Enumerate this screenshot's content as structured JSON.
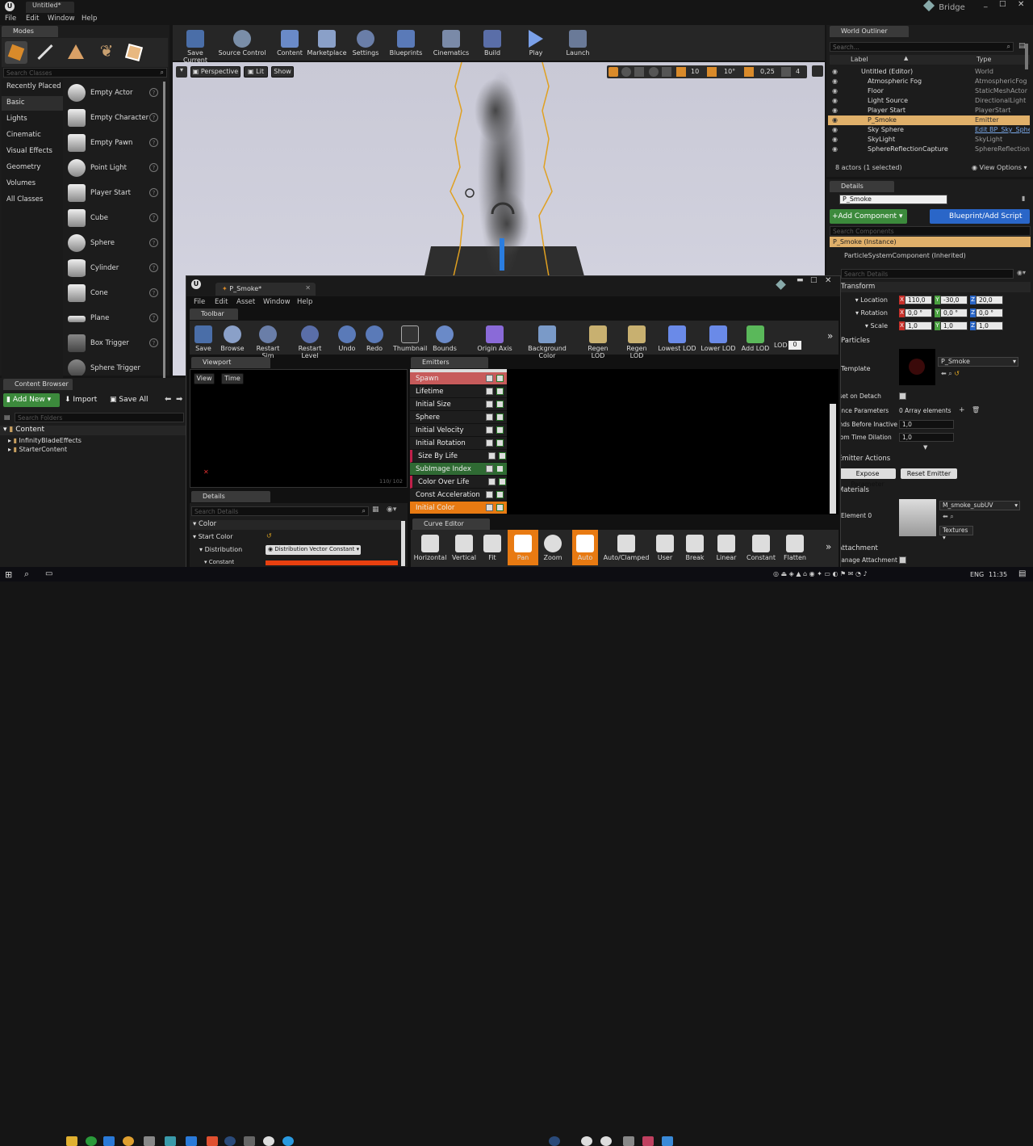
{
  "title_bar": {
    "title": "Untitled*",
    "bridge": "Bridge"
  },
  "main_menu": [
    "File",
    "Edit",
    "Window",
    "Help"
  ],
  "modes": {
    "tab": "Modes",
    "search_placeholder": "Search Classes",
    "categories": [
      "Recently Placed",
      "Basic",
      "Lights",
      "Cinematic",
      "Visual Effects",
      "Geometry",
      "Volumes",
      "All Classes"
    ],
    "items": [
      "Empty Actor",
      "Empty Character",
      "Empty Pawn",
      "Point Light",
      "Player Start",
      "Cube",
      "Sphere",
      "Cylinder",
      "Cone",
      "Plane",
      "Box Trigger",
      "Sphere Trigger"
    ]
  },
  "main_toolbar": [
    "Save Current",
    "Source Control",
    "Content",
    "Marketplace",
    "Settings",
    "Blueprints",
    "Cinematics",
    "Build",
    "Play",
    "Launch"
  ],
  "viewport": {
    "perspective": "Perspective",
    "lit": "Lit",
    "show": "Show",
    "grid_snap": "10",
    "rot_snap": "10°",
    "scale_snap": "0,25",
    "cam_speed": "4"
  },
  "world_outliner": {
    "tab": "World Outliner",
    "search_placeholder": "Search...",
    "col_label": "Label",
    "col_type": "Type",
    "rows": [
      {
        "label": "Untitled (Editor)",
        "type": "World"
      },
      {
        "label": "Atmospheric Fog",
        "type": "AtmosphericFog"
      },
      {
        "label": "Floor",
        "type": "StaticMeshActor"
      },
      {
        "label": "Light Source",
        "type": "DirectionalLight"
      },
      {
        "label": "Player Start",
        "type": "PlayerStart"
      },
      {
        "label": "P_Smoke",
        "type": "Emitter"
      },
      {
        "label": "Sky Sphere",
        "type": "Edit BP_Sky_Sphe"
      },
      {
        "label": "SkyLight",
        "type": "SkyLight"
      },
      {
        "label": "SphereReflectionCapture",
        "type": "SphereReflectionC"
      }
    ],
    "footer": "8 actors (1 selected)",
    "view_options": "View Options"
  },
  "details_right": {
    "tab": "Details",
    "name": "P_Smoke",
    "add_component": "+Add Component",
    "blueprint_script": "Blueprint/Add Script",
    "search_components": "Search Components",
    "instance": "P_Smoke (Instance)",
    "component": "ParticleSystemComponent (Inherited)",
    "search_details": "Search Details",
    "transform": "Transform",
    "location_label": "Location",
    "rotation_label": "Rotation",
    "scale_label": "Scale",
    "location": [
      "110,0",
      "-30,0",
      "20,0"
    ],
    "rotation": [
      "0,0 °",
      "0,0 °",
      "0,0 °"
    ],
    "scale": [
      "1,0",
      "1,0",
      "1,0"
    ],
    "particles": "Particles",
    "template": "Template",
    "template_value": "P_Smoke",
    "reset_on_detach": "Reset on Detach",
    "instance_params": "Instance Parameters",
    "instance_params_value": "0 Array elements",
    "seconds_before": "Seconds Before Inactive",
    "seconds_value": "1,0",
    "custom_dilation": "Custom Time Dilation",
    "dilation_value": "1,0",
    "emitter_actions": "Emitter Actions",
    "expose_param": "Expose Parameter",
    "reset_emitter": "Reset Emitter",
    "materials": "Materials",
    "element0": "Element 0",
    "material_name": "M_smoke_subUV",
    "textures": "Textures",
    "attachment": "Attachment",
    "auto_manage": "Auto Manage Attachment"
  },
  "content_browser": {
    "tab": "Content Browser",
    "add_new": "Add New",
    "import": "Import",
    "save_all": "Save All",
    "search_folders": "Search Folders",
    "root": "Content",
    "folders": [
      "InfinityBladeEffects",
      "StarterContent"
    ]
  },
  "cascade": {
    "tab_title": "P_Smoke*",
    "menu": [
      "File",
      "Edit",
      "Asset",
      "Window",
      "Help"
    ],
    "toolbar_tab": "Toolbar",
    "toolbar": [
      "Save",
      "Browse",
      "Restart Sim",
      "Restart Level",
      "Undo",
      "Redo",
      "Thumbnail",
      "Bounds",
      "Origin Axis",
      "Background Color",
      "Regen LOD",
      "Regen LOD",
      "Lowest LOD",
      "Lower LOD",
      "Add LOD"
    ],
    "lod_label": "LOD",
    "lod_value": "0",
    "viewport_tab": "Viewport",
    "view_btn": "View",
    "time_btn": "Time",
    "viewport_stats": "110/ 102",
    "emitters_tab": "Emitters",
    "modules": [
      {
        "name": "Spawn",
        "bg": "#c75b5b",
        "marker": ""
      },
      {
        "name": "Lifetime",
        "bg": "#1e1e1e",
        "marker": ""
      },
      {
        "name": "Initial Size",
        "bg": "#1e1e1e",
        "marker": ""
      },
      {
        "name": "Sphere",
        "bg": "#1e1e1e",
        "marker": ""
      },
      {
        "name": "Initial Velocity",
        "bg": "#1e1e1e",
        "marker": ""
      },
      {
        "name": "Initial Rotation",
        "bg": "#1e1e1e",
        "marker": ""
      },
      {
        "name": "Size By Life",
        "bg": "#1e1e1e",
        "marker": "#c0204a"
      },
      {
        "name": "SubImage Index",
        "bg": "#2f6a33",
        "marker": ""
      },
      {
        "name": "Color Over Life",
        "bg": "#1e1e1e",
        "marker": "#c0204a"
      },
      {
        "name": "Const Acceleration",
        "bg": "#1e1e1e",
        "marker": ""
      },
      {
        "name": "Initial Color",
        "bg": "#e87a12",
        "marker": ""
      }
    ],
    "details_tab": "Details",
    "details_search": "Search Details",
    "color_section": "Color",
    "start_color": "Start Color",
    "distribution": "Distribution",
    "distribution_value": "Distribution Vector Constant",
    "constant": "Constant",
    "curve_tab": "Curve Editor",
    "curve_toolbar": [
      "Horizontal",
      "Vertical",
      "Fit",
      "Pan",
      "Zoom",
      "Auto",
      "Auto/Clamped",
      "User",
      "Break",
      "Linear",
      "Constant",
      "Flatten"
    ]
  },
  "taskbar": {
    "lang": "ENG",
    "time": "11:35"
  }
}
